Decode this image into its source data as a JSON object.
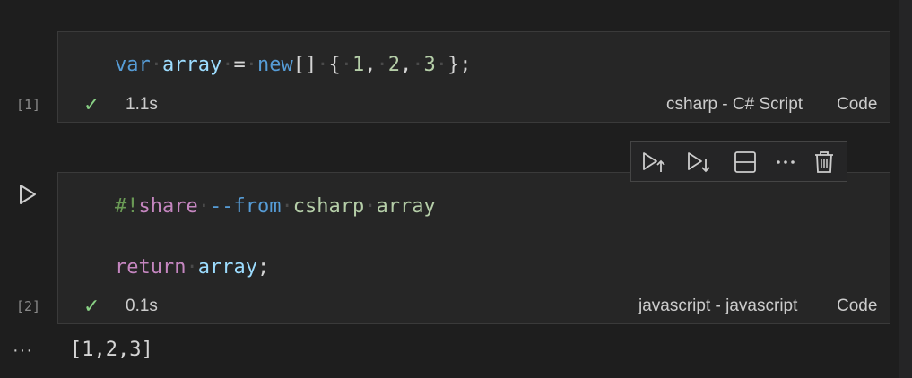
{
  "cells": [
    {
      "exec_count": "[1]",
      "code_lines": [
        {
          "tokens": [
            {
              "t": "var",
              "c": "kw"
            },
            {
              "t": "·",
              "c": "ws"
            },
            {
              "t": "array",
              "c": "var"
            },
            {
              "t": "·",
              "c": "ws"
            },
            {
              "t": "=",
              "c": "punc"
            },
            {
              "t": "·",
              "c": "ws"
            },
            {
              "t": "new",
              "c": "kw"
            },
            {
              "t": "[]",
              "c": "punc"
            },
            {
              "t": "·",
              "c": "ws"
            },
            {
              "t": "{",
              "c": "punc"
            },
            {
              "t": "·",
              "c": "ws"
            },
            {
              "t": "1",
              "c": "num"
            },
            {
              "t": ",",
              "c": "punc"
            },
            {
              "t": "·",
              "c": "ws"
            },
            {
              "t": "2",
              "c": "num"
            },
            {
              "t": ",",
              "c": "punc"
            },
            {
              "t": "·",
              "c": "ws"
            },
            {
              "t": "3",
              "c": "num"
            },
            {
              "t": "·",
              "c": "ws"
            },
            {
              "t": "};",
              "c": "punc"
            }
          ]
        }
      ],
      "status_icon": "check-icon",
      "duration": "1.1s",
      "language": "csharp - C# Script",
      "cell_type": "Code"
    },
    {
      "exec_count": "[2]",
      "code_lines": [
        {
          "tokens": [
            {
              "t": "#!",
              "c": "green"
            },
            {
              "t": "share",
              "c": "mag"
            },
            {
              "t": "·",
              "c": "ws"
            },
            {
              "t": "--from",
              "c": "dash"
            },
            {
              "t": "·",
              "c": "ws"
            },
            {
              "t": "csharp",
              "c": "gtext"
            },
            {
              "t": "·",
              "c": "ws"
            },
            {
              "t": "array",
              "c": "gtext"
            }
          ]
        },
        {
          "tokens": [
            {
              "t": "return",
              "c": "mag"
            },
            {
              "t": "·",
              "c": "ws"
            },
            {
              "t": "array",
              "c": "var"
            },
            {
              "t": ";",
              "c": "punc"
            }
          ]
        }
      ],
      "status_icon": "check-icon",
      "duration": "0.1s",
      "language": "javascript - javascript",
      "cell_type": "Code",
      "output": "[1,2,3]"
    }
  ],
  "toolbar": {
    "buttons": [
      "execute-above-icon",
      "execute-below-icon",
      "split-cell-icon",
      "more-actions-icon",
      "delete-icon"
    ]
  },
  "output_menu_glyph": "···",
  "colors": {
    "background": "#1e1e1e",
    "cell_background": "#262626",
    "keyword": "#569cd6",
    "variable": "#9cdcfe",
    "number": "#b5cea8",
    "magic": "#c586c0",
    "success": "#89d185"
  }
}
